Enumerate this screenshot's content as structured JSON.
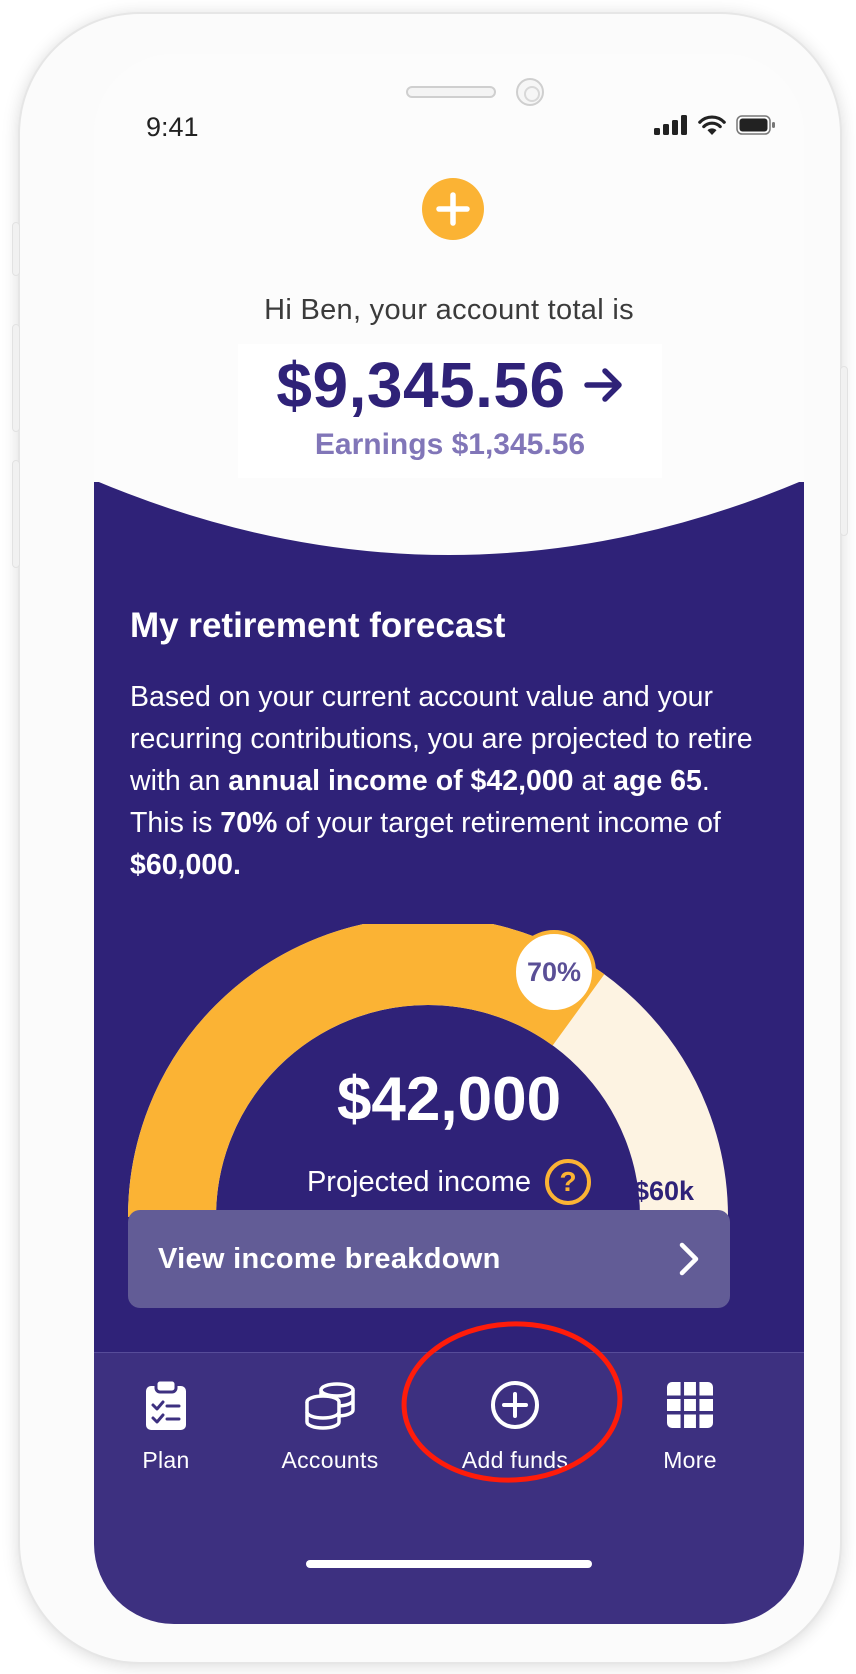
{
  "status": {
    "time": "9:41"
  },
  "account": {
    "greeting": "Hi Ben, your account total is",
    "total": "$9,345.56",
    "earnings": "Earnings $1,345.56"
  },
  "forecast": {
    "title": "My retirement forecast",
    "body_parts": {
      "p1": "Based on your current account value and your recurring contributions, you are projected to retire with an ",
      "b1": "annual income of $42,000",
      "p2": " at ",
      "b2": "age 65",
      "p3": ". This is ",
      "b3": "70%",
      "p4": " of your target retirement income of ",
      "b4": "$60,000."
    },
    "projected_amount": "$42,000",
    "projected_label": "Projected income",
    "help_glyph": "?",
    "percent_label": "70%",
    "percent_value": 70,
    "target_label": "$60k",
    "breakdown_button": "View income breakdown"
  },
  "tabs": [
    {
      "label": "Plan",
      "icon": "clipboard-check-icon"
    },
    {
      "label": "Accounts",
      "icon": "coins-stack-icon"
    },
    {
      "label": "Add funds",
      "icon": "plus-circle-icon"
    },
    {
      "label": "More",
      "icon": "grid-icon"
    }
  ],
  "colors": {
    "brand_purple": "#2f2278",
    "accent_orange": "#fbb334",
    "gauge_remaining": "#fdf3e2",
    "annotation_red": "#ff1c0a"
  }
}
